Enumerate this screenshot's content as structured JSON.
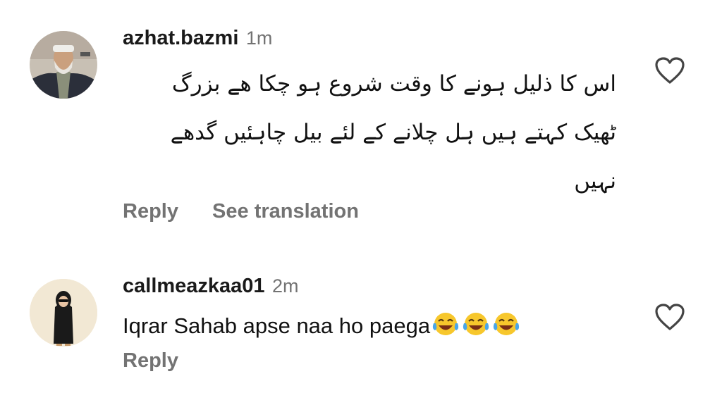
{
  "comments": [
    {
      "username": "azhat.bazmi",
      "time": "1m",
      "text_lines": [
        "اس کا ذلیل ہونے کا وقت شروع ہو چکا ھے بزرگ",
        "ٹھیک کہتے ہیں ہل چلانے کے لئے بیل چاہئیں گدھے",
        "نہیں"
      ],
      "reply_label": "Reply",
      "translate_label": "See translation"
    },
    {
      "username": "callmeazkaa01",
      "time": "2m",
      "text": "Iqrar Sahab apse naa ho paega",
      "emoji": [
        "face-with-tears-of-joy",
        "face-with-tears-of-joy",
        "face-with-tears-of-joy"
      ],
      "reply_label": "Reply"
    }
  ],
  "colors": {
    "secondary_text": "#737373",
    "primary_text": "#111111",
    "avatar2_bg": "#f2e8d4"
  }
}
